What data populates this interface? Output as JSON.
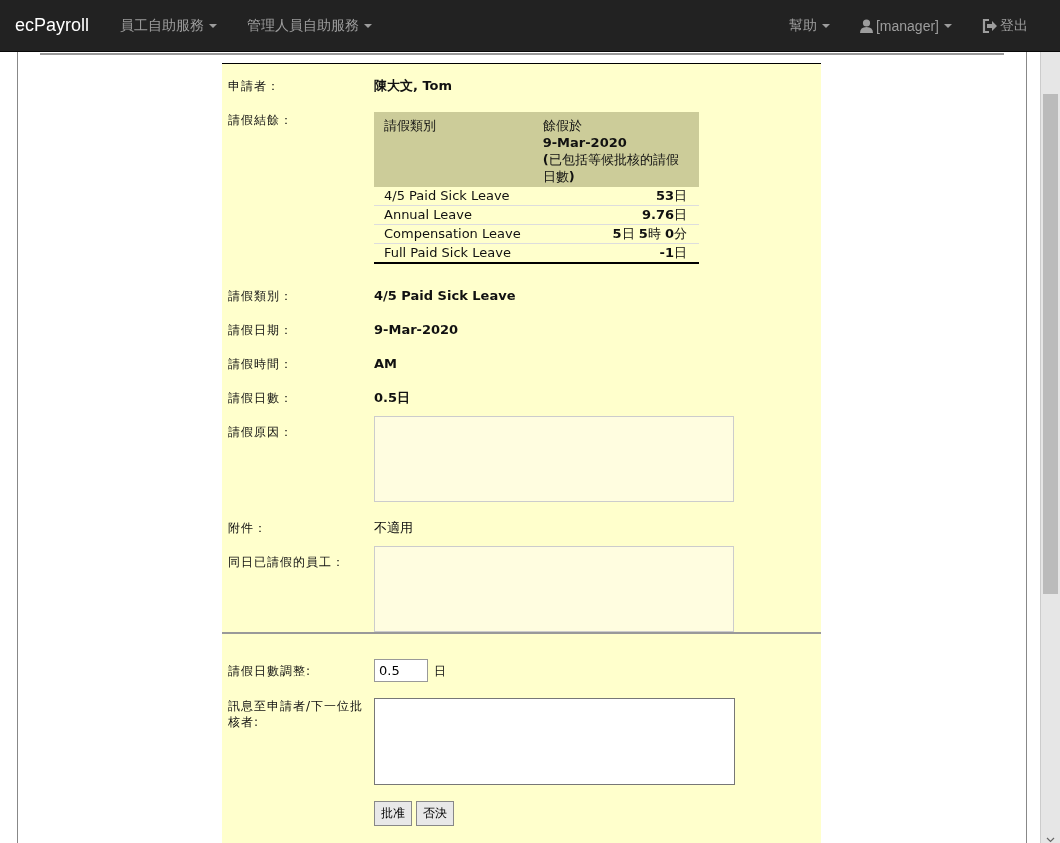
{
  "navbar": {
    "brand": "ecPayroll",
    "menus_left": [
      {
        "label": "員工自助服務",
        "kind": "dropdown"
      },
      {
        "label": "管理人員自助服務",
        "kind": "dropdown"
      }
    ],
    "menus_right": [
      {
        "label": "幫助",
        "kind": "dropdown"
      },
      {
        "label": "[manager]",
        "kind": "user"
      },
      {
        "label": "登出",
        "kind": "logout"
      }
    ]
  },
  "form": {
    "applicant": {
      "label": "申請者：",
      "value": "陳大文, Tom"
    },
    "balance": {
      "label": "請假結餘：",
      "columns": [
        "請假類別",
        [
          "餘假於",
          "**9-Mar-2020**",
          "**(**已包括等候批核的請假日數**)**"
        ]
      ],
      "rows": [
        {
          "type": "4/5 Paid Sick Leave",
          "remaining": "**53**日"
        },
        {
          "type": "Annual Leave",
          "remaining": "**9.76**日"
        },
        {
          "type": "Compensation Leave",
          "remaining": "**5**日 **5**時 **0**分"
        },
        {
          "type": "Full Paid Sick Leave",
          "remaining": "**-1**日"
        }
      ]
    },
    "details": [
      {
        "label": "請假類別：",
        "value": "4/5 Paid Sick Leave",
        "kind": "bold"
      },
      {
        "label": "請假日期：",
        "value": "9-Mar-2020",
        "kind": "bold"
      },
      {
        "label": "請假時間：",
        "value": "AM",
        "kind": "bold"
      },
      {
        "label": "請假日數：",
        "value": "**0.5**日",
        "kind": "bold"
      },
      {
        "label": "請假原因：",
        "kind": "readonly-box"
      },
      {
        "label": "附件：",
        "value": "不適用",
        "kind": "plain"
      },
      {
        "label": "同日已請假的員工：",
        "kind": "readonly-box"
      }
    ],
    "adjustment": {
      "label": "請假日數調整:",
      "value": "0.5",
      "unit": "日"
    },
    "message": {
      "label": "訊息至申請者/下一位批核者:"
    },
    "buttons": [
      "批准",
      "否決"
    ]
  }
}
